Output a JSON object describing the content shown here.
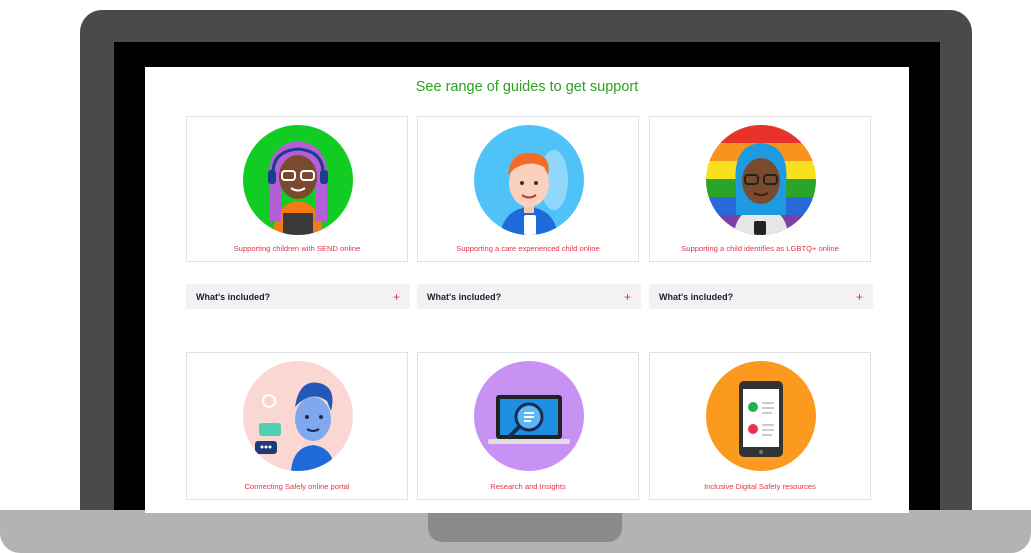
{
  "page": {
    "heading": "See range of guides to get support"
  },
  "cards": [
    {
      "caption": "Supporting children with SEND online",
      "icon": "headset-avatar-icon",
      "bg": "#11cc22"
    },
    {
      "caption": "Supporting a care experienced child online",
      "icon": "child-avatar-icon",
      "bg": "#4fc3f7"
    },
    {
      "caption": "Supporting a child identifies as LGBTQ+ online",
      "icon": "rainbow-avatar-icon",
      "bg": "#rainbow"
    },
    {
      "caption": "Connecting Safely online portal",
      "icon": "chat-avatar-icon",
      "bg": "#fbd7d3"
    },
    {
      "caption": "Research and Insights",
      "icon": "magnifier-laptop-icon",
      "bg": "#c792f4"
    },
    {
      "caption": "Inclusive Digital Safety resources",
      "icon": "phone-checklist-icon",
      "bg": "#fb9a1e"
    }
  ],
  "accordion": [
    {
      "label": "What's included?",
      "toggle": "+"
    },
    {
      "label": "What's included?",
      "toggle": "+"
    },
    {
      "label": "What's included?",
      "toggle": "+"
    }
  ],
  "colors": {
    "heading": "#2aa31d",
    "caption": "#e8334a",
    "accordion_bg": "#f2f2f4"
  }
}
